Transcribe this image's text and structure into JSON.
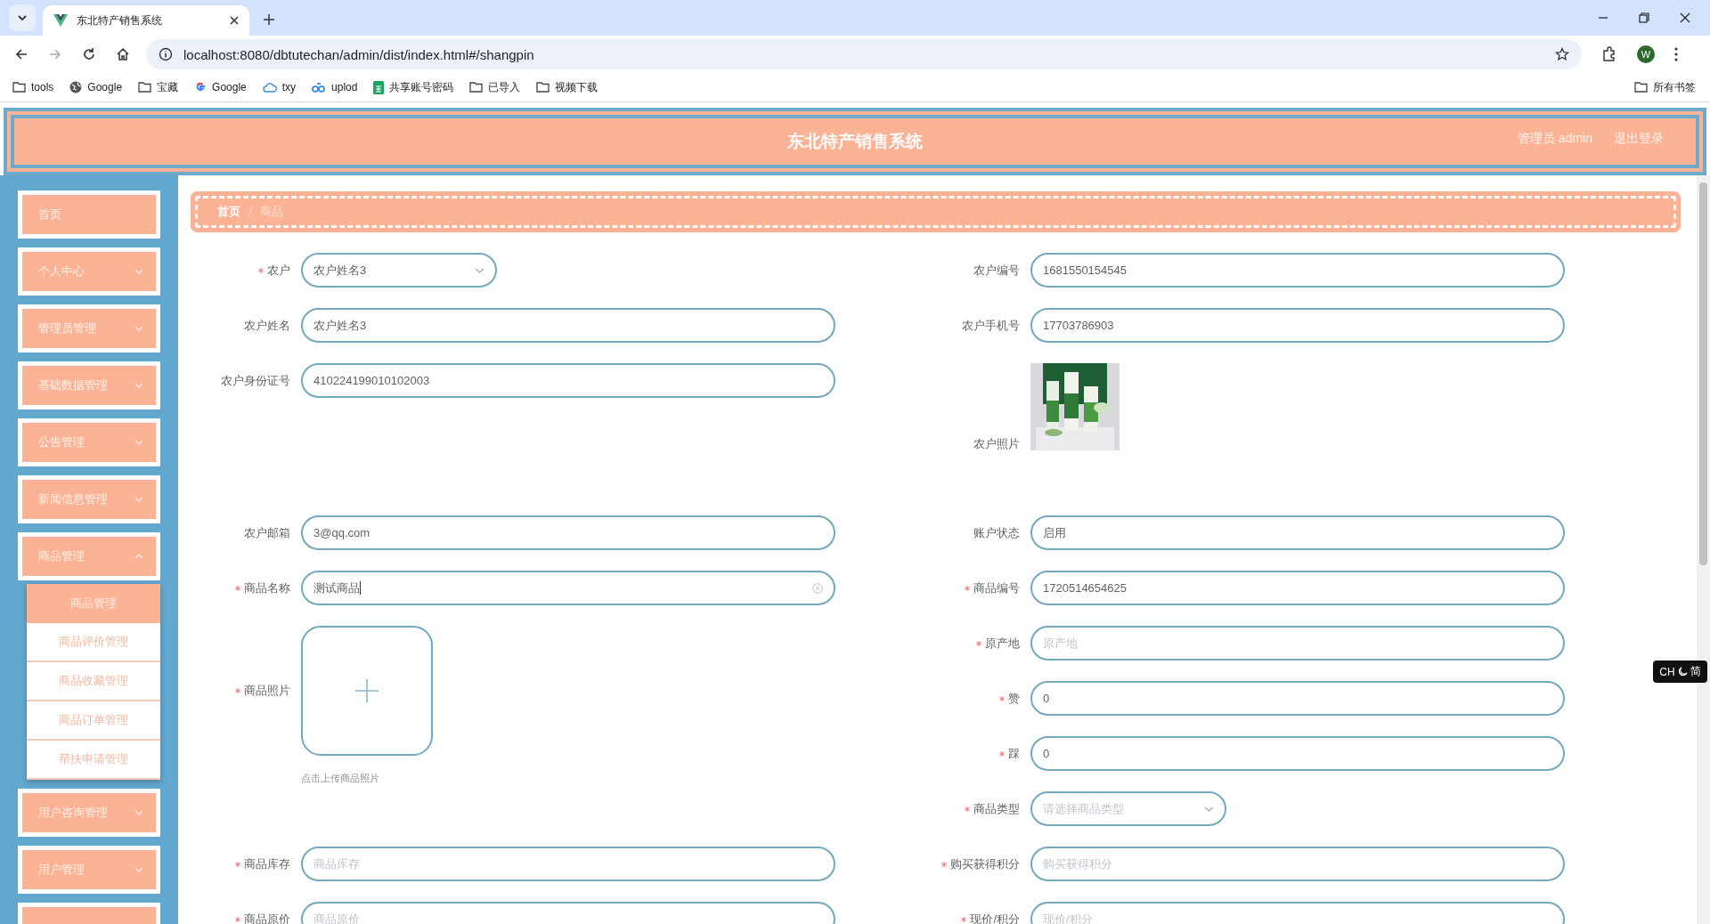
{
  "browser": {
    "tab_title": "东北特产销售系统",
    "url": "localhost:8080/dbtutechan/admin/dist/index.html#/shangpin",
    "profile_initial": "W",
    "bookmarks": [
      {
        "label": "tools",
        "kind": "folder"
      },
      {
        "label": "Google",
        "kind": "globe"
      },
      {
        "label": "宝藏",
        "kind": "folder"
      },
      {
        "label": "Google",
        "kind": "google"
      },
      {
        "label": "txy",
        "kind": "cloud"
      },
      {
        "label": "uplod",
        "kind": "link"
      },
      {
        "label": "共享账号密码",
        "kind": "sheet"
      },
      {
        "label": "已导入",
        "kind": "folder"
      },
      {
        "label": "视频下载",
        "kind": "folder"
      }
    ],
    "all_bookmarks": "所有书签"
  },
  "header": {
    "title": "东北特产销售系统",
    "user": "管理员 admin",
    "logout": "退出登录"
  },
  "sidebar": {
    "items": [
      {
        "label": "首页",
        "expandable": false
      },
      {
        "label": "个人中心",
        "expandable": true,
        "expanded": false
      },
      {
        "label": "管理员管理",
        "expandable": true,
        "expanded": false
      },
      {
        "label": "基础数据管理",
        "expandable": true,
        "expanded": false
      },
      {
        "label": "公告管理",
        "expandable": true,
        "expanded": false
      },
      {
        "label": "新闻信息管理",
        "expandable": true,
        "expanded": false
      },
      {
        "label": "商品管理",
        "expandable": true,
        "expanded": true,
        "children": [
          {
            "label": "商品管理",
            "selected": true
          },
          {
            "label": "商品评价管理",
            "selected": false
          },
          {
            "label": "商品收藏管理",
            "selected": false
          },
          {
            "label": "商品订单管理",
            "selected": false
          },
          {
            "label": "帮扶申请管理",
            "selected": false
          }
        ]
      },
      {
        "label": "用户咨询管理",
        "expandable": true,
        "expanded": false
      },
      {
        "label": "用户管理",
        "expandable": true,
        "expanded": false
      }
    ]
  },
  "breadcrumb": [
    {
      "label": "首页",
      "selected": false
    },
    {
      "label": "商品",
      "selected": true
    }
  ],
  "form": {
    "left_fields": [
      {
        "label": "农户",
        "required": true,
        "kind": "select",
        "value": "农户姓名3"
      },
      {
        "label": "农户姓名",
        "required": false,
        "kind": "input",
        "value": "农户姓名3"
      },
      {
        "label": "农户身份证号",
        "required": false,
        "kind": "input",
        "value": "410224199010102003"
      },
      {
        "label": "农户邮箱",
        "required": false,
        "kind": "input",
        "value": "3@qq.com"
      },
      {
        "label": "商品名称",
        "required": true,
        "kind": "input",
        "value": "测试商品",
        "focused": true
      },
      {
        "label": "商品照片",
        "required": true,
        "kind": "upload",
        "hint": "点击上传商品照片"
      },
      {
        "label": "商品库存",
        "required": true,
        "kind": "input",
        "placeholder": "商品库存"
      },
      {
        "label": "商品原价",
        "required": true,
        "kind": "input",
        "placeholder": "商品原价"
      }
    ],
    "right_fields": [
      {
        "label": "农户编号",
        "required": false,
        "kind": "input",
        "value": "1681550154545"
      },
      {
        "label": "农户手机号",
        "required": false,
        "kind": "input",
        "value": "17703786903"
      },
      {
        "label": "农户照片",
        "required": false
      },
      {
        "label": "账户状态",
        "required": false,
        "kind": "input",
        "value": "启用"
      },
      {
        "label": "商品编号",
        "required": true,
        "kind": "input",
        "value": "1720514654625"
      },
      {
        "label": "原产地",
        "required": true,
        "kind": "input",
        "placeholder": "原产地"
      },
      {
        "label": "赞",
        "required": true,
        "kind": "input",
        "value": "0"
      },
      {
        "label": "踩",
        "required": true,
        "kind": "input",
        "value": "0"
      },
      {
        "label": "商品类型",
        "required": true,
        "kind": "select",
        "placeholder": "请选择商品类型"
      },
      {
        "label": "购买获得积分",
        "required": true,
        "kind": "input",
        "placeholder": "购买获得积分"
      },
      {
        "label": "现价/积分",
        "required": true,
        "kind": "input",
        "placeholder": "现价/积分"
      }
    ]
  },
  "ime_indicator": {
    "mode": "CH",
    "script": "简"
  }
}
